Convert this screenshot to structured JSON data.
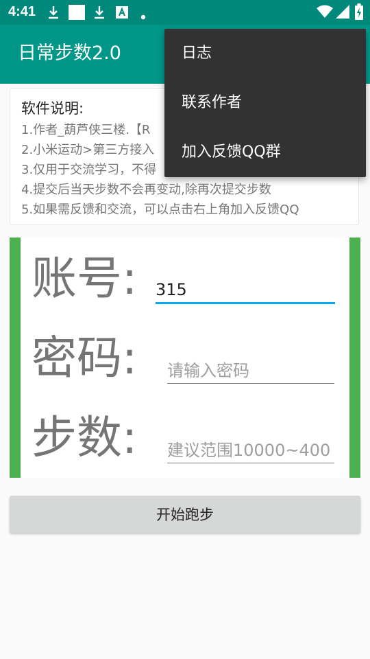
{
  "status_bar": {
    "time": "4:41",
    "icons": [
      "download-icon",
      "square-notification-icon",
      "download-icon",
      "text-a-icon",
      "dot-icon",
      "wifi-icon",
      "cell-signal-icon",
      "battery-charging-icon"
    ]
  },
  "app_bar": {
    "title": "日常步数2.0"
  },
  "info": {
    "title": "软件说明:",
    "lines": [
      "1.作者_葫芦侠三楼.【R",
      "2.小米运动>第三方接入",
      "3.仅用于交流学习，不得",
      "4.提交后当天步数不会再变动,除再次提交步数",
      "5.如果需反馈和交流，可以点击右上角加入反馈QQ"
    ]
  },
  "form": {
    "account_label": "账号:",
    "account_value": "315",
    "password_label": "密码:",
    "password_placeholder": "请输入密码",
    "steps_label": "步数:",
    "steps_placeholder": "建议范围10000~400"
  },
  "button": {
    "start_label": "开始跑步"
  },
  "menu": {
    "items": [
      "日志",
      "联系作者",
      "加入反馈QQ群"
    ]
  },
  "colors": {
    "status_bar": "#00897b",
    "app_bar": "#009688",
    "form_border": "#4caf50",
    "input_focus": "#03a9f4",
    "menu_bg": "#323232"
  }
}
